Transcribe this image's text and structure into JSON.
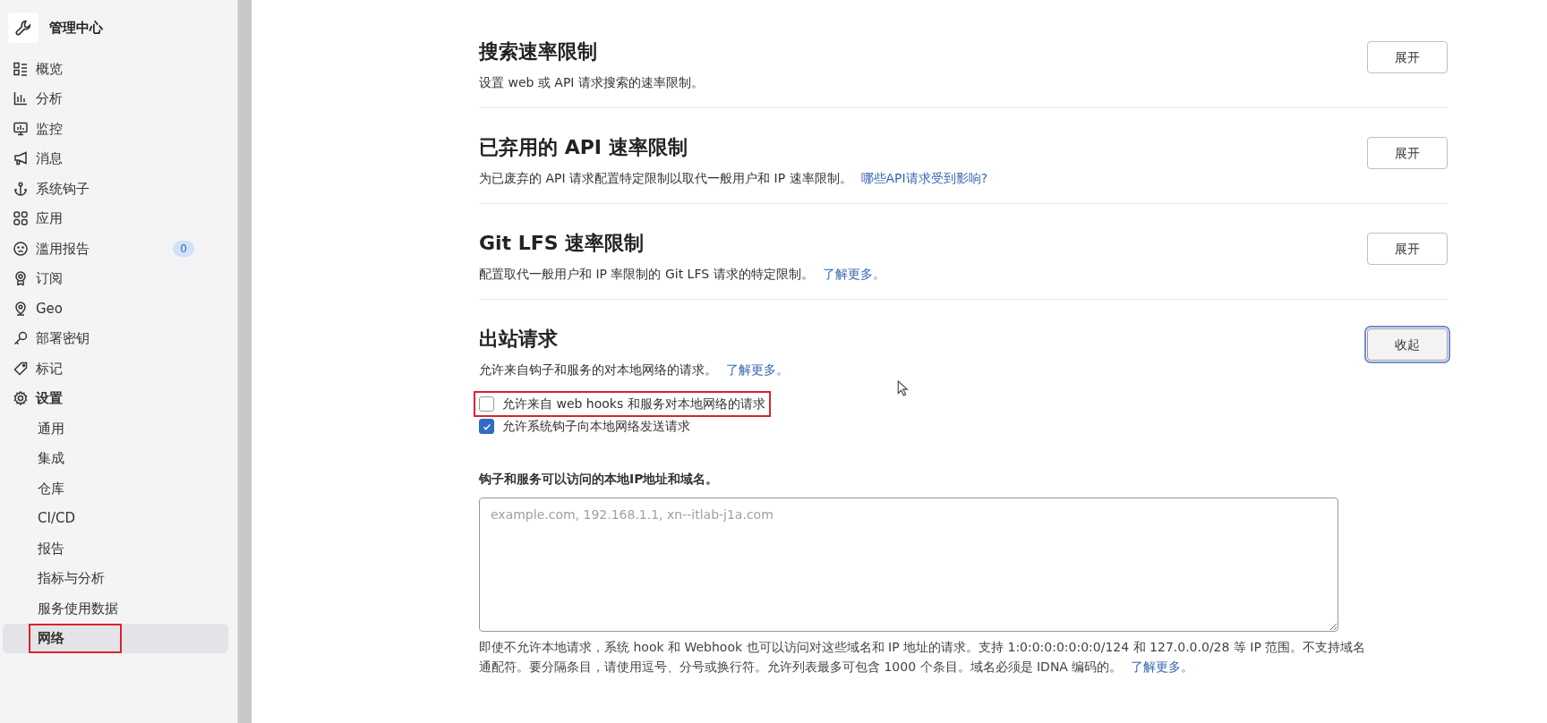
{
  "sidebar": {
    "title": "管理中心",
    "items": [
      {
        "label": "概览",
        "kind": "overview",
        "selected": false
      },
      {
        "label": "分析",
        "kind": "chart",
        "selected": false
      },
      {
        "label": "监控",
        "kind": "monitor",
        "selected": false
      },
      {
        "label": "消息",
        "kind": "megaphone",
        "selected": false
      },
      {
        "label": "系统钩子",
        "kind": "anchor",
        "selected": false
      },
      {
        "label": "应用",
        "kind": "apps",
        "selected": false
      },
      {
        "label": "滥用报告",
        "kind": "face",
        "selected": false,
        "badge": "0"
      },
      {
        "label": "订阅",
        "kind": "award",
        "selected": false
      },
      {
        "label": "Geo",
        "kind": "pin",
        "selected": false
      },
      {
        "label": "部署密钥",
        "kind": "key",
        "selected": false
      },
      {
        "label": "标记",
        "kind": "tag",
        "selected": false
      },
      {
        "label": "设置",
        "kind": "gear",
        "selected": false,
        "expanded": true,
        "children": [
          {
            "label": "通用",
            "selected": false,
            "highlighted": false
          },
          {
            "label": "集成",
            "selected": false,
            "highlighted": false
          },
          {
            "label": "仓库",
            "selected": false,
            "highlighted": false
          },
          {
            "label": "CI/CD",
            "selected": false,
            "highlighted": false
          },
          {
            "label": "报告",
            "selected": false,
            "highlighted": false
          },
          {
            "label": "指标与分析",
            "selected": false,
            "highlighted": false
          },
          {
            "label": "服务使用数据",
            "selected": false,
            "highlighted": false
          },
          {
            "label": "网络",
            "selected": true,
            "highlighted": true
          }
        ]
      }
    ]
  },
  "sections": [
    {
      "title": "搜索速率限制",
      "description": "设置 web 或 API 请求搜索的速率限制。",
      "button": "展开",
      "expanded": false
    },
    {
      "title": "已弃用的 API 速率限制",
      "description": "为已废弃的 API 请求配置特定限制以取代一般用户和 IP 速率限制。",
      "link": "哪些API请求受到影响?",
      "button": "展开",
      "expanded": false
    },
    {
      "title": "Git LFS 速率限制",
      "description": "配置取代一般用户和 IP 率限制的 Git LFS 请求的特定限制。",
      "link": "了解更多。",
      "button": "展开",
      "expanded": false
    },
    {
      "title": "出站请求",
      "description": "允许来自钩子和服务的对本地网络的请求。",
      "link": "了解更多。",
      "button": "收起",
      "expanded": true,
      "options": [
        {
          "label": "允许来自 web hooks 和服务对本地网络的请求",
          "checked": false,
          "highlighted": true
        },
        {
          "label": "允许系统钩子向本地网络发送请求",
          "checked": true,
          "highlighted": false
        }
      ],
      "field": {
        "label": "钩子和服务可以访问的本地IP地址和域名。",
        "placeholder": "example.com, 192.168.1.1, xn--itlab-j1a.com"
      },
      "help": "即使不允许本地请求，系统 hook 和 Webhook 也可以访问对这些域名和 IP 地址的请求。支持 1:0:0:0:0:0:0:0/124 和 127.0.0.0/28 等 IP 范围。不支持域名通配符。要分隔条目，请使用逗号、分号或换行符。允许列表最多可包含 1000 个条目。域名必须是 IDNA 编码的。",
      "help_link": "了解更多。"
    }
  ]
}
